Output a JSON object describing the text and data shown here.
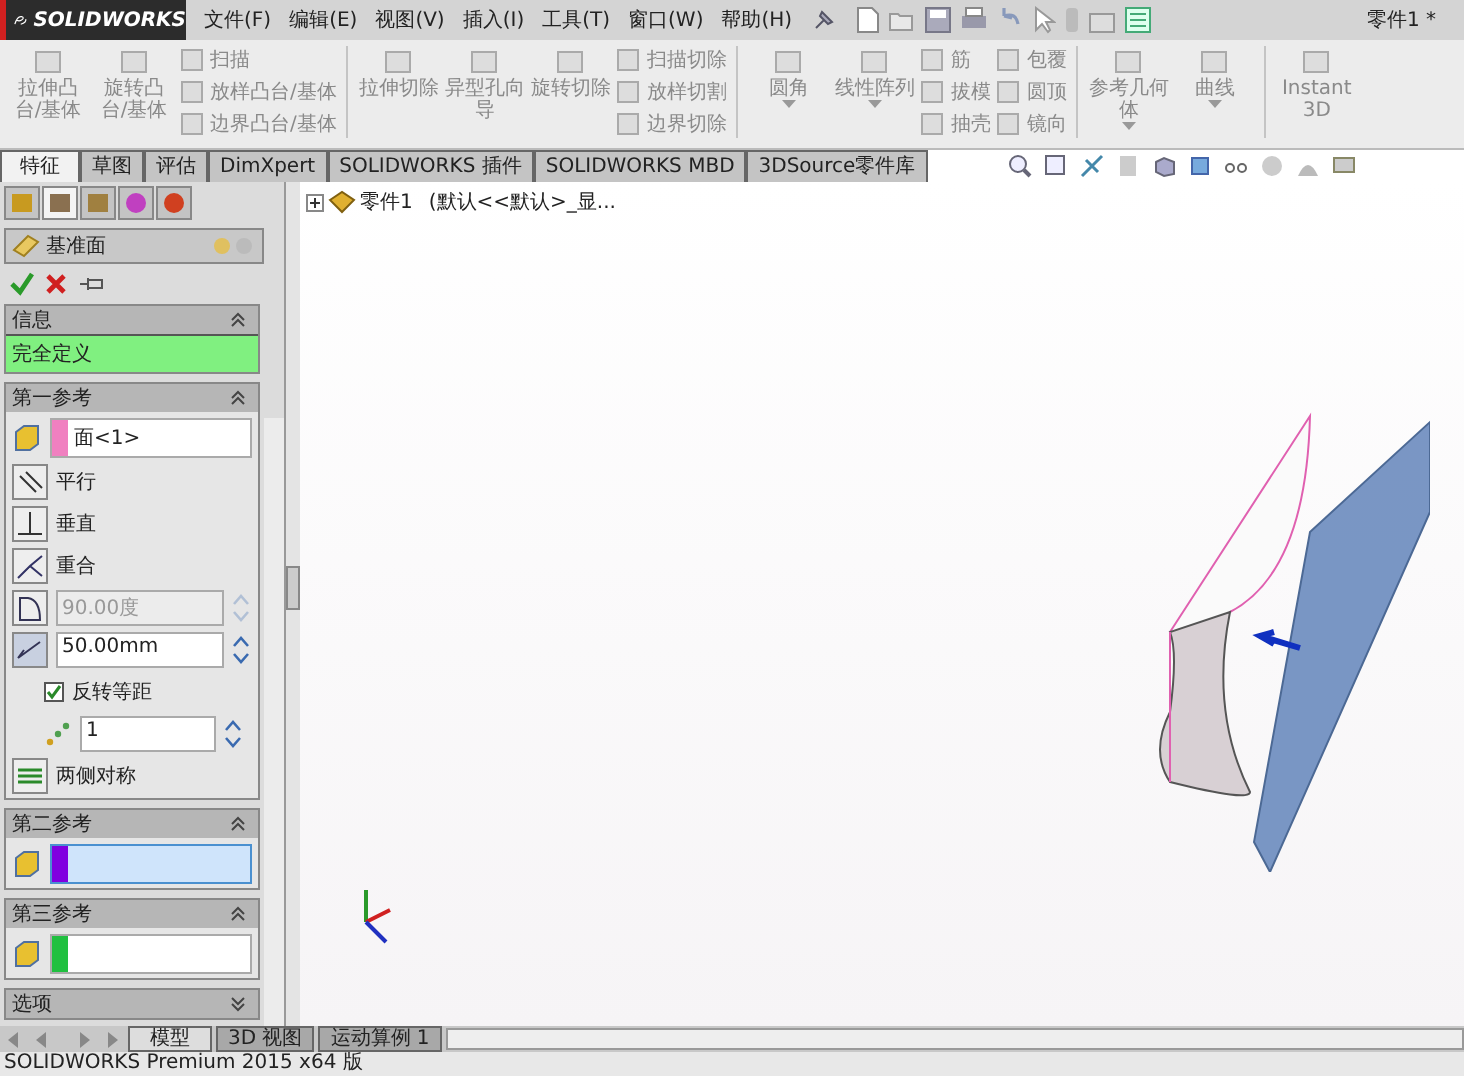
{
  "app": {
    "logo": "SOLIDWORKS",
    "menu": [
      "文件(F)",
      "编辑(E)",
      "视图(V)",
      "插入(I)",
      "工具(T)",
      "窗口(W)",
      "帮助(H)"
    ],
    "document_title": "零件1 *"
  },
  "ribbon": [
    {
      "kind": "large",
      "label": "拉伸凸台/基体",
      "dropdown": false
    },
    {
      "kind": "large",
      "label": "旋转凸台/基体",
      "dropdown": false
    },
    {
      "kind": "stack",
      "items": [
        "扫描",
        "放样凸台/基体",
        "边界凸台/基体"
      ]
    },
    {
      "kind": "separator"
    },
    {
      "kind": "large",
      "label": "拉伸切除",
      "dropdown": false
    },
    {
      "kind": "large",
      "label": "异型孔向导",
      "dropdown": false
    },
    {
      "kind": "large",
      "label": "旋转切除",
      "dropdown": false
    },
    {
      "kind": "stack",
      "items": [
        "扫描切除",
        "放样切割",
        "边界切除"
      ]
    },
    {
      "kind": "separator"
    },
    {
      "kind": "large",
      "label": "圆角",
      "dropdown": true
    },
    {
      "kind": "large",
      "label": "线性阵列",
      "dropdown": true
    },
    {
      "kind": "stack",
      "items": [
        "筋",
        "拔模",
        "抽壳"
      ]
    },
    {
      "kind": "stack",
      "items": [
        "包覆",
        "圆顶",
        "镜向"
      ]
    },
    {
      "kind": "separator"
    },
    {
      "kind": "large",
      "label": "参考几何体",
      "dropdown": true
    },
    {
      "kind": "large",
      "label": "曲线",
      "dropdown": true
    },
    {
      "kind": "separator"
    },
    {
      "kind": "large",
      "label": "Instant3D",
      "dropdown": false
    }
  ],
  "command_tabs": [
    {
      "label": "特征",
      "selected": true
    },
    {
      "label": "草图",
      "selected": false
    },
    {
      "label": "评估",
      "selected": false
    },
    {
      "label": "DimXpert",
      "selected": false
    },
    {
      "label": "SOLIDWORKS 插件",
      "selected": false
    },
    {
      "label": "SOLIDWORKS MBD",
      "selected": false
    },
    {
      "label": "3DSource零件库",
      "selected": false
    }
  ],
  "manager_tabs": [
    {
      "kind": "tree",
      "selected": false
    },
    {
      "kind": "property",
      "selected": true
    },
    {
      "kind": "configuration",
      "selected": false
    },
    {
      "kind": "dimxpert",
      "selected": false
    },
    {
      "kind": "display",
      "selected": false
    }
  ],
  "property_manager": {
    "title": "基准面",
    "sections": [
      {
        "title": "信息",
        "expanded": true,
        "kind": "message",
        "message": "完全定义"
      },
      {
        "title": "第一参考",
        "expanded": true,
        "kind": "reference",
        "selection": {
          "value": "面<1>",
          "color": "#f080c0",
          "focused": false
        },
        "rows": [
          {
            "kind": "parallel",
            "label": "平行"
          },
          {
            "kind": "perpendicular",
            "label": "垂直"
          },
          {
            "kind": "coincident",
            "label": "重合"
          },
          {
            "kind": "angle",
            "value": "90.00度",
            "disabled": true
          },
          {
            "kind": "distance",
            "value": "50.00mm",
            "disabled": false
          },
          {
            "kind": "checkbox",
            "label": "反转等距",
            "checked": true
          },
          {
            "kind": "count",
            "value": "1"
          },
          {
            "kind": "symmetric",
            "label": "两侧对称"
          }
        ]
      },
      {
        "title": "第二参考",
        "expanded": true,
        "kind": "reference",
        "selection": {
          "color": "#8000e0",
          "focused": true
        }
      },
      {
        "title": "第三参考",
        "expanded": true,
        "kind": "reference",
        "selection": {
          "color": "#20c040",
          "focused": false
        }
      },
      {
        "title": "选项",
        "expanded": false
      }
    ]
  },
  "model_tree": {
    "expanded": false,
    "root": "零件1",
    "config": "(默认<<默认>_显..."
  },
  "bottom_tabs": [
    {
      "label": "模型",
      "selected": true
    },
    {
      "label": "3D 视图",
      "selected": false
    },
    {
      "label": "运动算例 1",
      "selected": false
    }
  ],
  "status_bar": "SOLIDWORKS Premium 2015 x64 版"
}
